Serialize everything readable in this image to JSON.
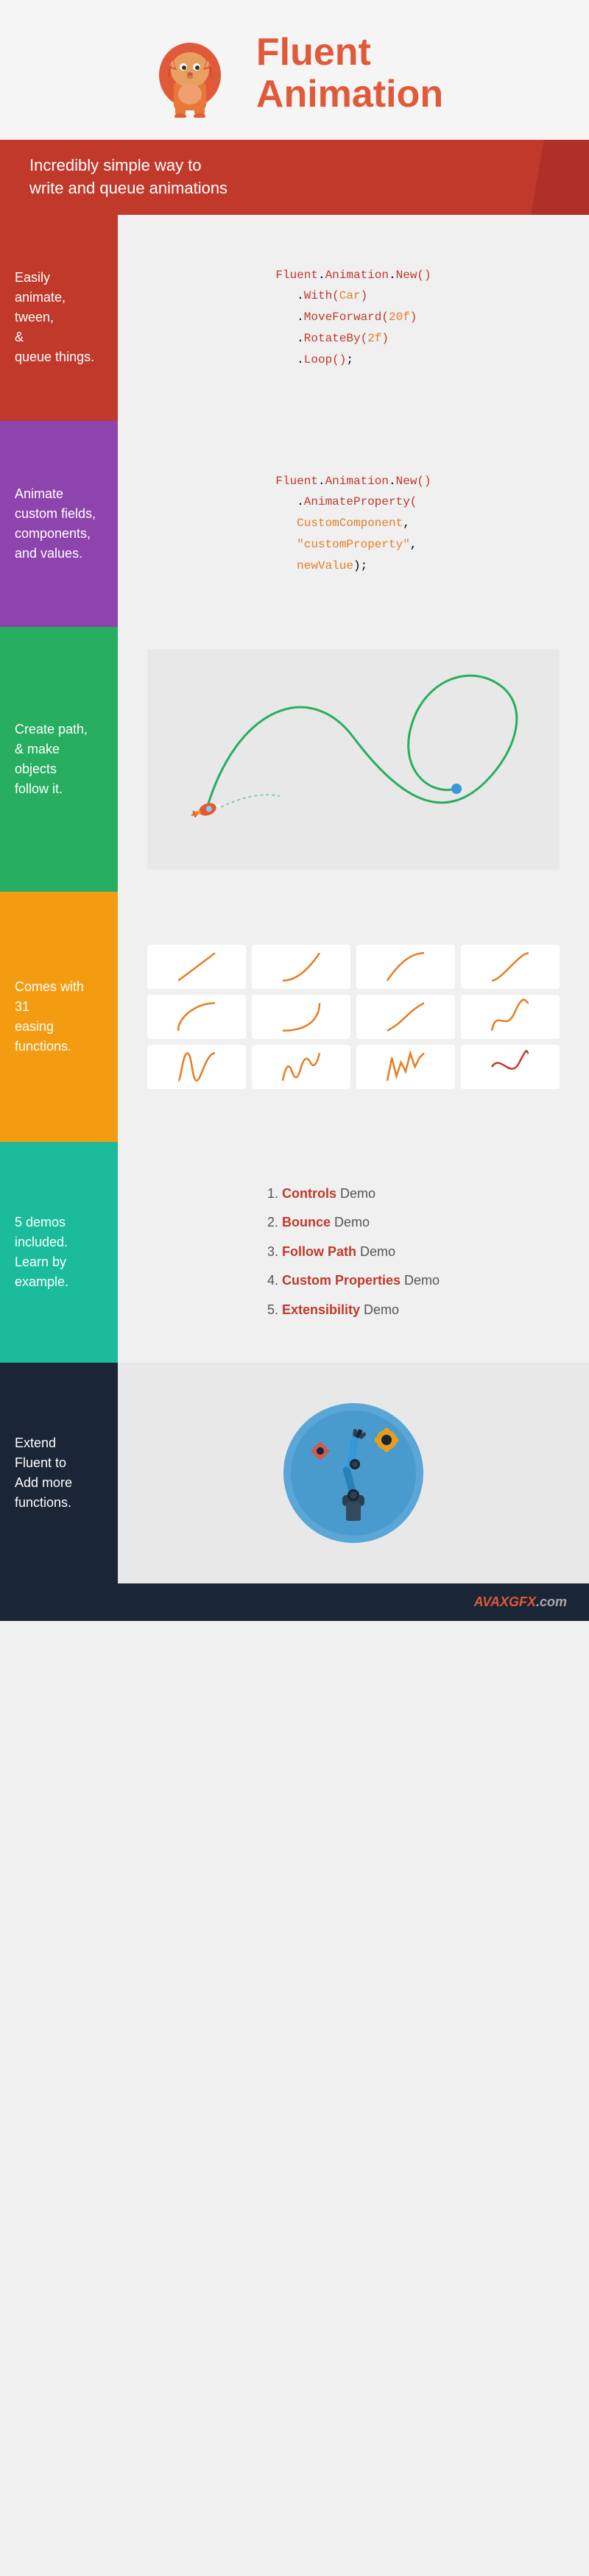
{
  "header": {
    "title_line1": "Fluent",
    "title_line2": "Animation",
    "logo_alt": "Lion logo"
  },
  "tagline": {
    "text": "Incredibly simple way to\nwrite and queue animations"
  },
  "sections": [
    {
      "id": "animate",
      "sidebar_text": "Easily animate,\ntween,\n&\nqueue things.",
      "code": [
        "Fluent.Animation.New()",
        "   .With(Car)",
        "   .MoveForward(20f)",
        "   .RotateBy(2f)",
        "   .Loop();"
      ]
    },
    {
      "id": "custom-fields",
      "sidebar_text": "Animate\ncustom fields,\ncomponents,\nand values.",
      "code": [
        "Fluent.Animation.New()",
        "   .AnimateProperty(",
        "   CustomComponent,",
        "   \"customProperty\",",
        "   newValue);"
      ]
    },
    {
      "id": "path",
      "sidebar_text": "Create path,\n& make\nobjects\nfollow it."
    },
    {
      "id": "easing",
      "sidebar_text": "Comes with\n31\neasing\nfunctions."
    },
    {
      "id": "demos",
      "sidebar_text": "5 demos\nincluded.\nLearn by\nexample.",
      "demos": [
        {
          "number": "1.",
          "name": "Controls",
          "label": "Demo"
        },
        {
          "number": "2.",
          "name": "Bounce",
          "label": "Demo"
        },
        {
          "number": "3.",
          "name": "Follow Path",
          "label": "Demo"
        },
        {
          "number": "4.",
          "name": "Custom Properties",
          "label": "Demo"
        },
        {
          "number": "5.",
          "name": "Extensibility",
          "label": "Demo"
        }
      ]
    },
    {
      "id": "extend",
      "sidebar_text": "Extend\nFluent to\nAdd more\nfunctions."
    }
  ],
  "watermark": {
    "text": "AVAXGFX",
    "suffix": ".com"
  }
}
